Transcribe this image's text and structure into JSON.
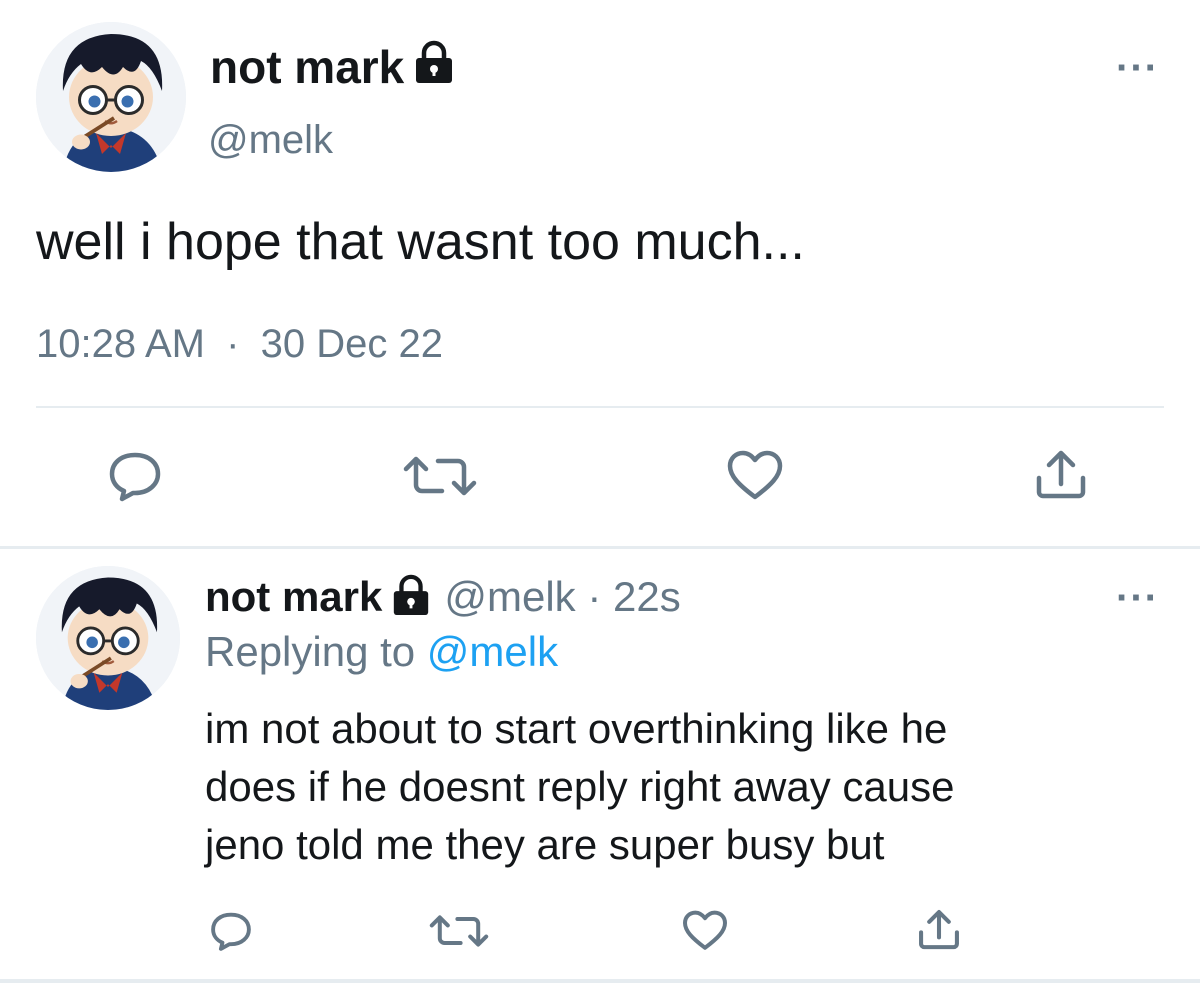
{
  "tweet": {
    "display_name": "not mark",
    "handle": "@melk",
    "text": "well i hope that wasnt too much...",
    "time": "10:28 AM",
    "separator": "·",
    "date": "30 Dec 22",
    "more_label": "···",
    "avatar_icon": "anime-boy-glasses-avatar",
    "lock_icon": "lock-icon"
  },
  "reply": {
    "display_name": "not mark",
    "handle_time": "@melk · 22s",
    "replying_prefix": "Replying to",
    "replying_mention": "@melk",
    "lines": [
      "im not about to start overthinking like he",
      "does if he doesnt reply right away cause",
      "jeno told me they are super busy but"
    ],
    "more_label": "···"
  },
  "colors": {
    "text": "#14171a",
    "secondary": "#657786",
    "link": "#1da1f2",
    "divider": "#e6ecf0",
    "icon": "#657786"
  }
}
